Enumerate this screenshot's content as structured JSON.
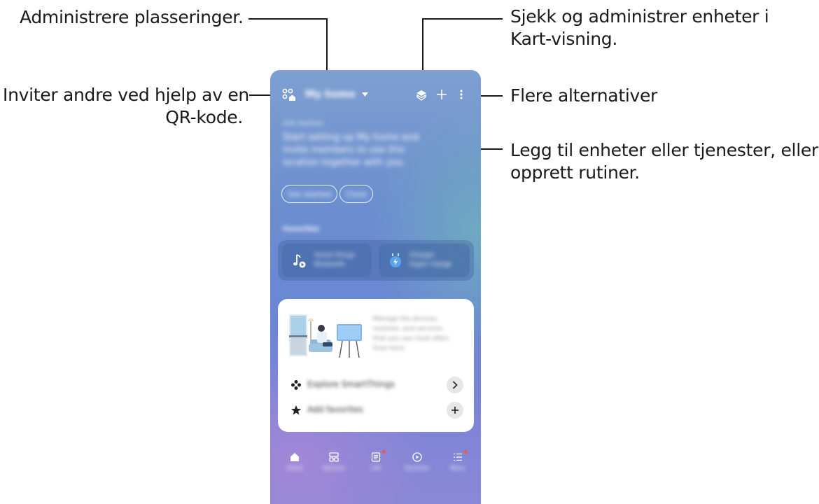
{
  "callouts": {
    "locations": "Administrere plasseringer.",
    "qr_line1": "Inviter andre ved hjelp av en",
    "qr_line2": "QR-kode.",
    "map_line1": "Sjekk og administrer enheter i",
    "map_line2": "Kart-visning.",
    "more": "Flere alternativer",
    "add_line1": "Legg til enheter eller tjenester, eller",
    "add_line2": "opprett rutiner."
  },
  "phone": {
    "location_name": "My home",
    "promo_text": [
      "Get started",
      "Start setting up My home and",
      "invite members to use this",
      "location together with you."
    ],
    "promo_buttons": [
      "Get started",
      "Close"
    ],
    "favorites_title": "Favorites",
    "fav_cards": [
      {
        "title": "Smart things",
        "subtitle": "Bluetooth",
        "icon": "music-note-play-icon"
      },
      {
        "title": "Charger",
        "subtitle": "Super charge",
        "icon": "charging-plug-icon"
      }
    ],
    "card_text": [
      "Manage the devices,",
      "routines, and services",
      "that you use most often",
      "from here."
    ],
    "card_rows": [
      {
        "label": "Explore SmartThings",
        "icon": "smartthings-icon",
        "action_icon": "chevron-right-icon"
      },
      {
        "label": "Add favorites",
        "icon": "star-icon",
        "action_icon": "plus-icon"
      }
    ],
    "nav_labels": [
      "Home",
      "Devices",
      "Life",
      "Routines",
      "Menu"
    ]
  },
  "colors": {
    "accent_dot": "#f0584a",
    "callout_text": "#1a1a1a"
  }
}
